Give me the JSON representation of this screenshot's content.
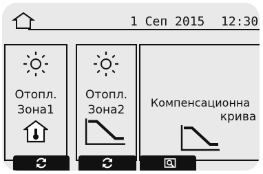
{
  "header": {
    "date": "1 Сеп 2015",
    "time": "12:30"
  },
  "cards": [
    {
      "line1": "Отопл.",
      "line2": "Зона1",
      "icon": "sun-icon",
      "bottom_icon": "refresh-icon"
    },
    {
      "line1": "Отопл.",
      "line2": "Зона2",
      "icon": "sun-icon",
      "bottom_icon": "refresh-icon"
    },
    {
      "line1": "Компенсационна",
      "line2": "крива",
      "bottom_icon": "search-icon"
    }
  ],
  "colors": {
    "screen_bg": "#e9e9e9",
    "ink": "#111111",
    "white": "#ffffff"
  }
}
